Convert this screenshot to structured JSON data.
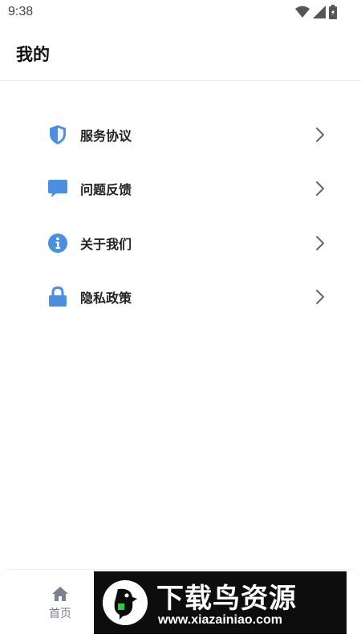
{
  "status_bar": {
    "time": "9:38",
    "icons": [
      "wifi-icon",
      "signal-icon",
      "battery-icon"
    ]
  },
  "header": {
    "title": "我的"
  },
  "menu": {
    "items": [
      {
        "label": "服务协议",
        "icon": "shield-icon"
      },
      {
        "label": "问题反馈",
        "icon": "chat-bubble-icon"
      },
      {
        "label": "关于我们",
        "icon": "info-icon"
      },
      {
        "label": "隐私政策",
        "icon": "lock-icon"
      }
    ]
  },
  "bottom_nav": {
    "home_label": "首页",
    "home_icon": "home-icon"
  },
  "watermark": {
    "title": "下载鸟资源",
    "url": "www.xiazainiao.com"
  },
  "colors": {
    "accent": "#4a8fe0",
    "chevron": "#666666",
    "nav_text": "#7a8290"
  }
}
